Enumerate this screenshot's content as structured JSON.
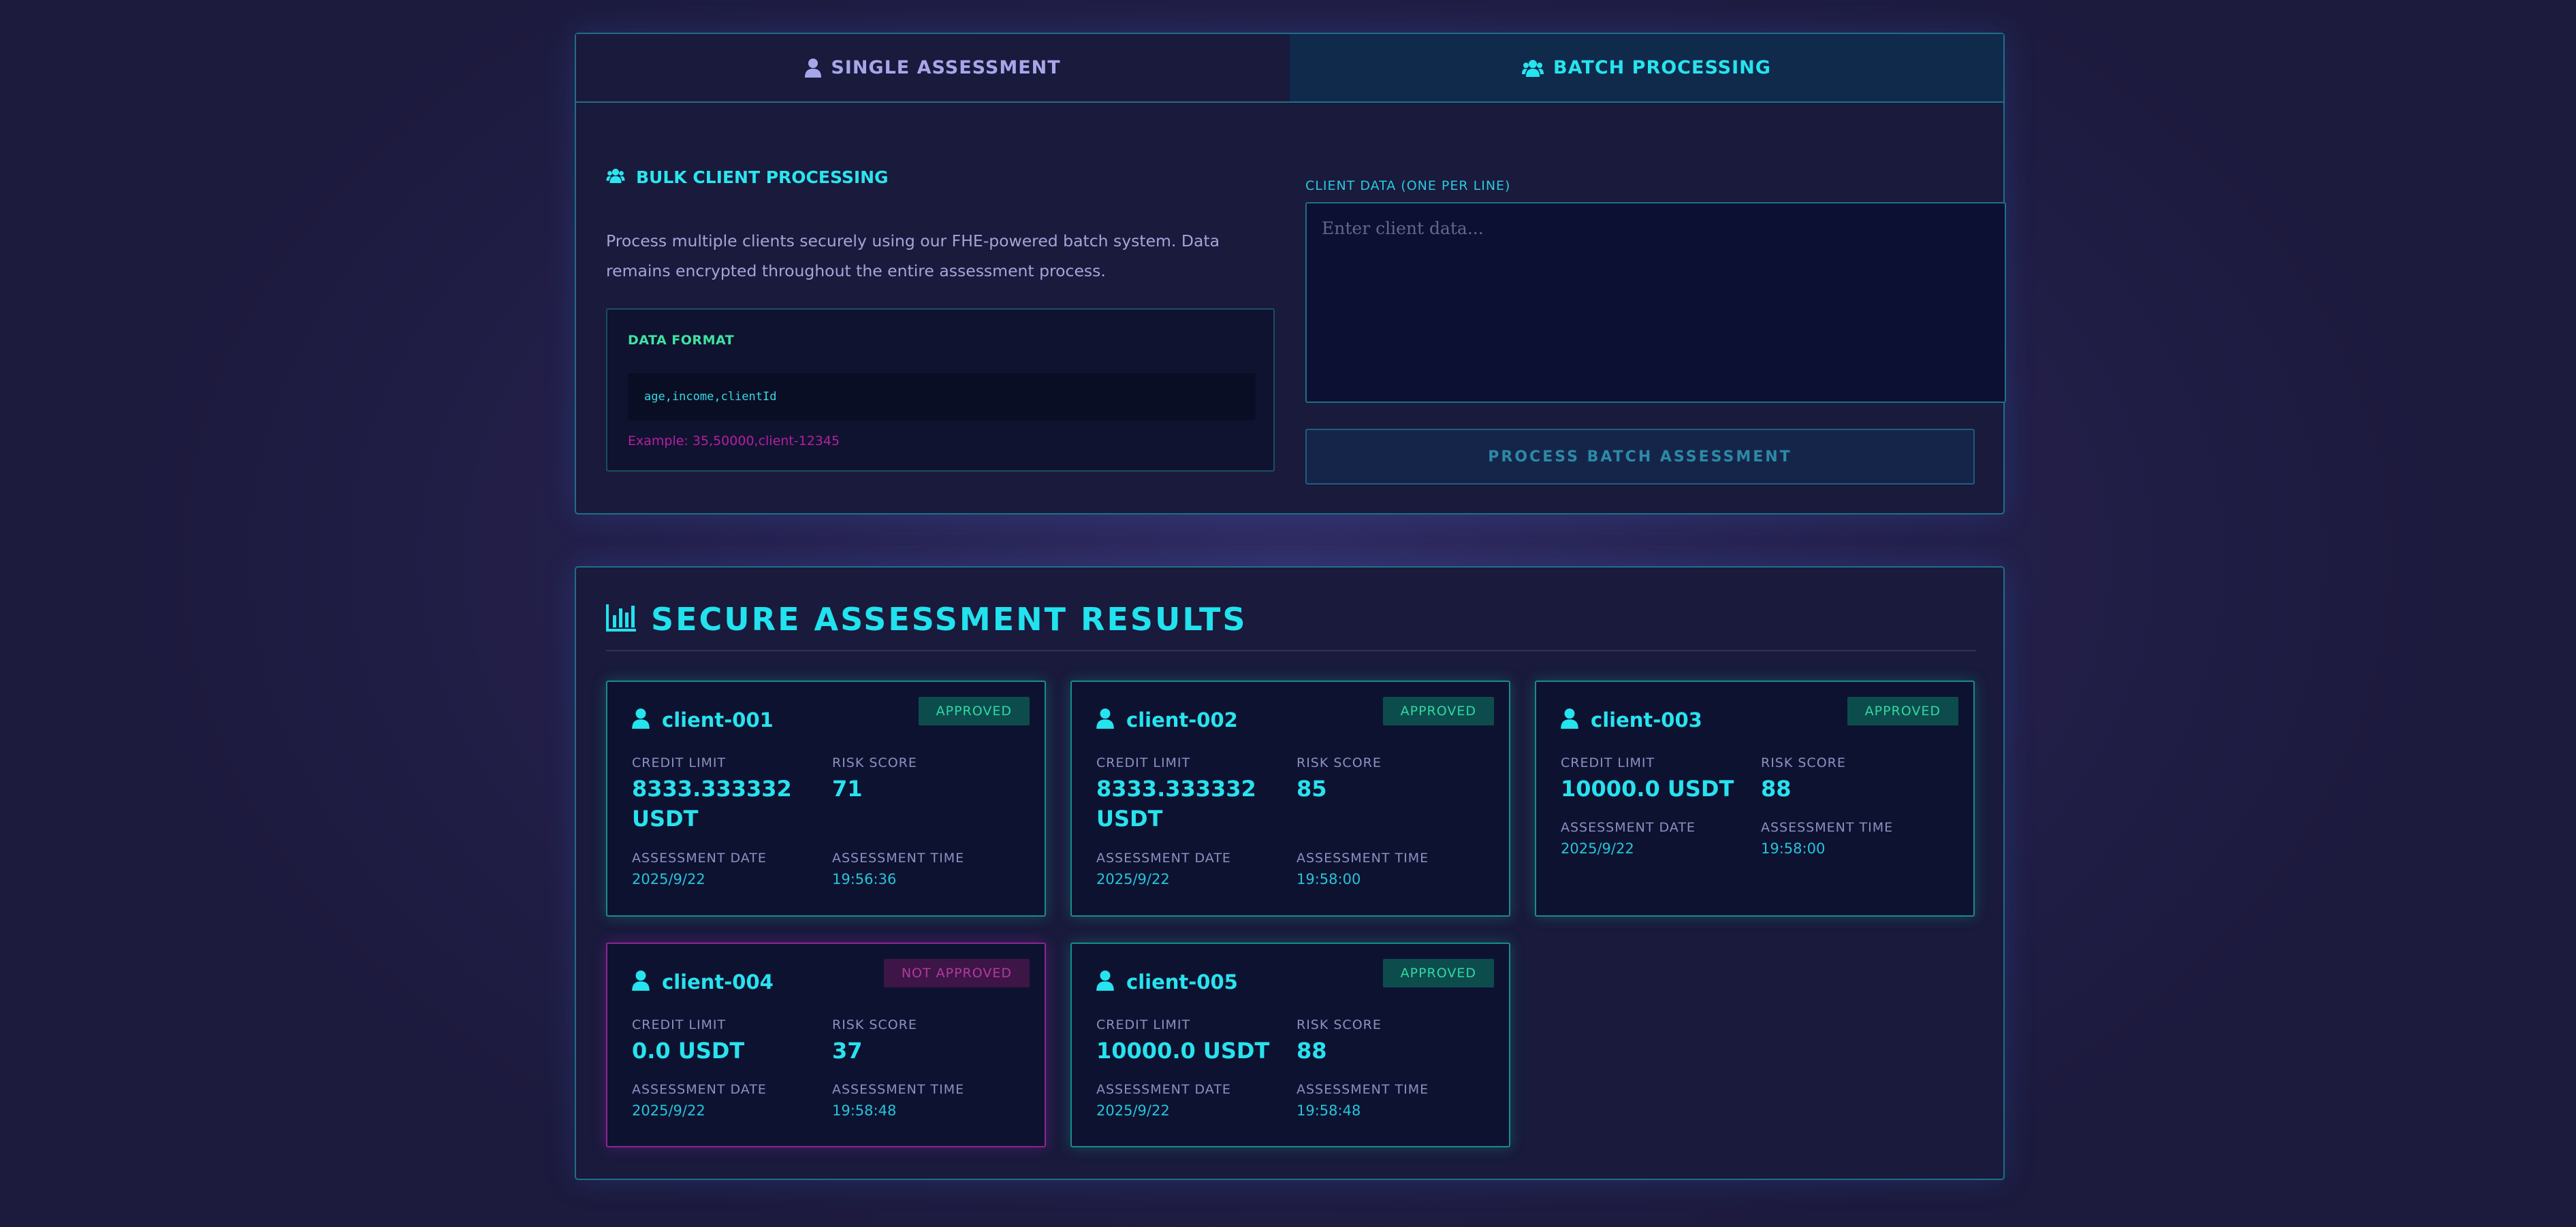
{
  "tabs": {
    "single": "SINGLE ASSESSMENT",
    "batch": "BATCH PROCESSING"
  },
  "batch": {
    "heading": "BULK CLIENT PROCESSING",
    "description": "Process multiple clients securely using our FHE-powered batch system. Data remains encrypted throughout the entire assessment process.",
    "format_title": "DATA FORMAT",
    "format_code": "age,income,clientId",
    "format_example": "Example: 35,50000,client-12345",
    "field_label": "CLIENT DATA (ONE PER LINE)",
    "placeholder": "Enter client data...",
    "button": "PROCESS BATCH ASSESSMENT"
  },
  "results": {
    "title": "SECURE ASSESSMENT RESULTS",
    "labels": {
      "credit_limit": "CREDIT LIMIT",
      "risk_score": "RISK SCORE",
      "date": "ASSESSMENT DATE",
      "time": "ASSESSMENT TIME"
    },
    "cards": [
      {
        "client": "client-001",
        "status": "APPROVED",
        "credit_limit": "8333.333332 USDT",
        "risk_score": "71",
        "date": "2025/9/22",
        "time": "19:56:36"
      },
      {
        "client": "client-002",
        "status": "APPROVED",
        "credit_limit": "8333.333332 USDT",
        "risk_score": "85",
        "date": "2025/9/22",
        "time": "19:58:00"
      },
      {
        "client": "client-003",
        "status": "APPROVED",
        "credit_limit": "10000.0 USDT",
        "risk_score": "88",
        "date": "2025/9/22",
        "time": "19:58:00"
      },
      {
        "client": "client-004",
        "status": "NOT APPROVED",
        "credit_limit": "0.0 USDT",
        "risk_score": "37",
        "date": "2025/9/22",
        "time": "19:58:48"
      },
      {
        "client": "client-005",
        "status": "APPROVED",
        "credit_limit": "10000.0 USDT",
        "risk_score": "88",
        "date": "2025/9/22",
        "time": "19:58:48"
      }
    ]
  },
  "colors": {
    "accent": "#22e2ee",
    "approved": "#2fd9a6",
    "rejected": "#b13a9e",
    "border": "#1f6f86"
  },
  "icons": {
    "single_tab": "user-icon",
    "batch_tab": "users-icon",
    "batch_heading": "users-icon",
    "results_heading": "bar-chart-icon",
    "card": "user-icon"
  }
}
